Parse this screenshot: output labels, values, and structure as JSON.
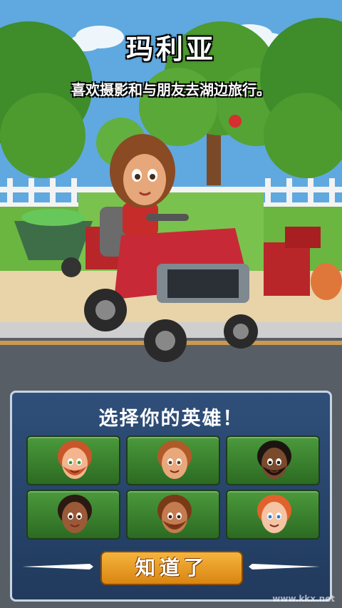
{
  "hero": {
    "name": "玛利亚",
    "description": "喜欢摄影和与朋友去湖边旅行。"
  },
  "panel": {
    "title": "选择你的英雄！",
    "confirm_label": "知道了"
  },
  "characters": [
    {
      "skin": "#f2b58e",
      "hair": "#c9562a",
      "beard": true,
      "eyes": "#3a9b3a"
    },
    {
      "skin": "#e9a77c",
      "hair": "#b05a2a",
      "beard": false,
      "eyes": "#5a3a1e"
    },
    {
      "skin": "#7a4a2c",
      "hair": "#1c1410",
      "beard": true,
      "eyes": "#2a1a10"
    },
    {
      "skin": "#9a5a38",
      "hair": "#2a1a12",
      "beard": false,
      "eyes": "#3a2214"
    },
    {
      "skin": "#c47b50",
      "hair": "#7a3a18",
      "beard": true,
      "eyes": "#3a2214"
    },
    {
      "skin": "#f4c4a4",
      "hair": "#e0622c",
      "beard": false,
      "eyes": "#2a7ad0"
    }
  ],
  "watermark": "www.kkx.net",
  "colors": {
    "card": "#3f8a32",
    "button": "#e8992a",
    "panel": "#29466d"
  }
}
